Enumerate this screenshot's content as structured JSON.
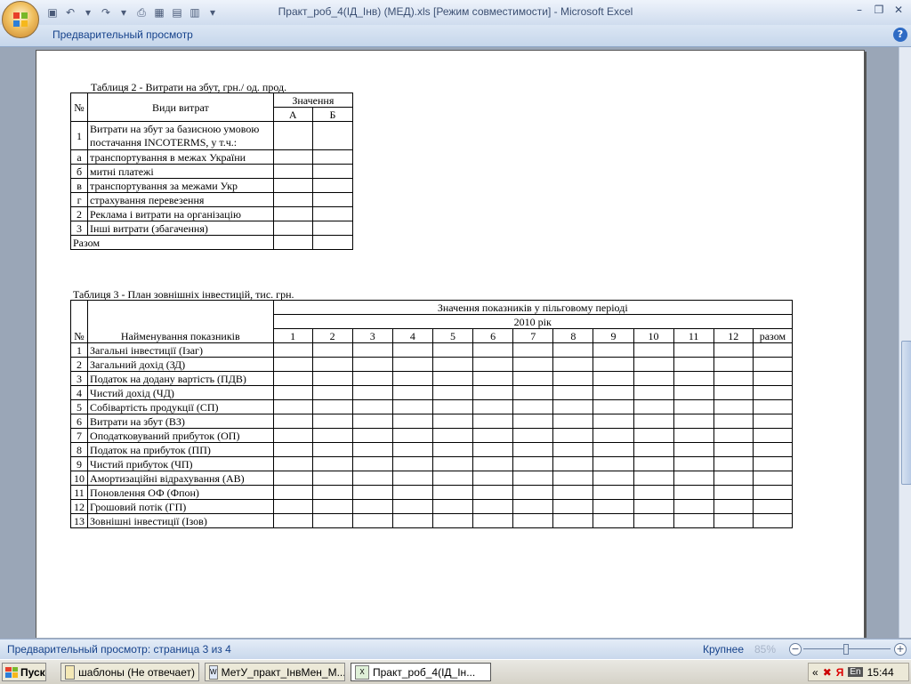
{
  "window": {
    "title": "Практ_роб_4(ІД_Інв) (МЕД).xls  [Режим совместимости] - Microsoft Excel",
    "controls": [
      "–",
      "❐",
      "✕"
    ]
  },
  "ribbon": {
    "tab": "Предварительный просмотр",
    "help": "?"
  },
  "table2": {
    "caption": "Таблиця 2 - Витрати на збут, грн./ од. прод.",
    "h_num": "№",
    "h_kind": "Види витрат",
    "h_values": "Значення",
    "h_a": "А",
    "h_b": "Б",
    "rows": [
      {
        "num": "1",
        "name": "Витрати на збут за базисною умовою постачання INCOTERMS, у т.ч.:"
      },
      {
        "num": "а",
        "name": "транспортування в межах України"
      },
      {
        "num": "б",
        "name": "митні платежі"
      },
      {
        "num": "в",
        "name": "транспортування за межами Укр"
      },
      {
        "num": "г",
        "name": "страхування перевезення"
      },
      {
        "num": "2",
        "name": "Реклама і витрати на організацію"
      },
      {
        "num": "3",
        "name": "Інші витрати (збагачення)"
      }
    ],
    "total": "Разом"
  },
  "table3": {
    "caption": "Таблиця 3 - План зовнішніх інвестицій, тис. грн.",
    "h_num": "№",
    "h_name": "Найменування показників",
    "h_values": "Значення показників у пільговому періоді",
    "h_year": "2010 рік",
    "months": [
      "1",
      "2",
      "3",
      "4",
      "5",
      "6",
      "7",
      "8",
      "9",
      "10",
      "11",
      "12"
    ],
    "h_total": "разом",
    "rows": [
      {
        "num": "1",
        "name": "Загальні інвестиції (Ізаг)"
      },
      {
        "num": "2",
        "name": "Загальний дохід (ЗД)"
      },
      {
        "num": "3",
        "name": "Податок на додану вартість (ПДВ)"
      },
      {
        "num": "4",
        "name": "Чистий дохід (ЧД)"
      },
      {
        "num": "5",
        "name": "Собівартість продукції (СП)"
      },
      {
        "num": "6",
        "name": "Витрати на збут (ВЗ)"
      },
      {
        "num": "7",
        "name": "Оподатковуваний прибуток (ОП)"
      },
      {
        "num": "8",
        "name": "Податок на прибуток (ПП)"
      },
      {
        "num": "9",
        "name": "Чистий прибуток (ЧП)"
      },
      {
        "num": "10",
        "name": "Амортизаційні відрахування (АВ)"
      },
      {
        "num": "11",
        "name": "Поновлення ОФ (Фпон)"
      },
      {
        "num": "12",
        "name": "Грошовий потік (ГП)"
      },
      {
        "num": "13",
        "name": "Зовнішні інвестиції (Ізов)"
      }
    ]
  },
  "status": {
    "text": "Предварительный просмотр: страница 3 из 4",
    "zoom_label": "Крупнее",
    "zoom_value": "85%",
    "zoom_minus": "−",
    "zoom_plus": "+"
  },
  "taskbar": {
    "start": "Пуск",
    "items": [
      "шаблоны (Не отвечает)",
      "МетУ_практ_ІнвМен_М...",
      "Практ_роб_4(ІД_Ін..."
    ],
    "tray_chevron": "«",
    "tray_lang": "En",
    "tray_ya": "Я",
    "time": "15:44"
  }
}
